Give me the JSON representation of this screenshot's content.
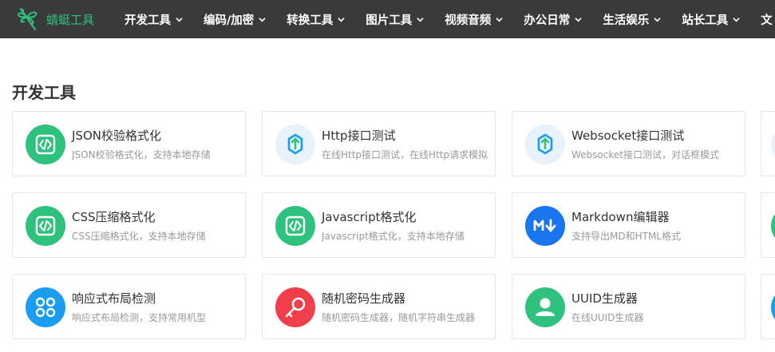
{
  "brand": {
    "name": "蜻蜓工具",
    "color": "#2ec27e"
  },
  "nav": {
    "items": [
      {
        "label": "开发工具"
      },
      {
        "label": "编码/加密"
      },
      {
        "label": "转换工具"
      },
      {
        "label": "图片工具"
      },
      {
        "label": "视频音频"
      },
      {
        "label": "办公日常"
      },
      {
        "label": "生活娱乐"
      },
      {
        "label": "站长工具"
      },
      {
        "label": "文"
      }
    ]
  },
  "section": {
    "title": "开发工具"
  },
  "tools": [
    {
      "title": "JSON校验格式化",
      "desc": "JSON校验格式化，支持本地存储",
      "icon": "code-icon",
      "color": "#2ec27e"
    },
    {
      "title": "Http接口测试",
      "desc": "在线Http接口测试，在线Http请求模拟",
      "icon": "api-icon",
      "color": "#e8f2fb"
    },
    {
      "title": "Websocket接口测试",
      "desc": "Websocket接口测试，对话框模式",
      "icon": "api-icon",
      "color": "#e8f2fb"
    },
    {
      "title": "CSS压缩格式化",
      "desc": "CSS压缩格式化，支持本地存储",
      "icon": "code-icon",
      "color": "#2ec27e"
    },
    {
      "title": "Javascript格式化",
      "desc": "Javascript格式化，支持本地存储",
      "icon": "code-icon",
      "color": "#2ec27e"
    },
    {
      "title": "Markdown编辑器",
      "desc": "支持导出MD和HTML格式",
      "icon": "markdown-icon",
      "color": "#1976f0"
    },
    {
      "title": "响应式布局检测",
      "desc": "响应式布局检测，支持常用机型",
      "icon": "layout-icon",
      "color": "#1a9df0"
    },
    {
      "title": "随机密码生成器",
      "desc": "随机密码生成器，随机字符串生成器",
      "icon": "key-icon",
      "color": "#f03e4a"
    },
    {
      "title": "UUID生成器",
      "desc": "在线UUID生成器",
      "icon": "user-icon",
      "color": "#2ec27e"
    }
  ]
}
